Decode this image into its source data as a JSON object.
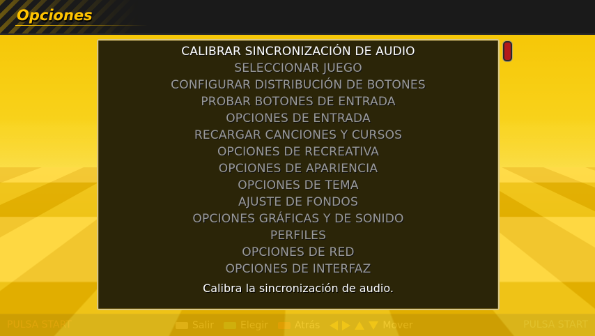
{
  "header": {
    "title": "Opciones"
  },
  "menu": {
    "items": [
      {
        "label": "CALIBRAR SINCRONIZACIÓN DE AUDIO",
        "selected": true
      },
      {
        "label": "SELECCIONAR JUEGO"
      },
      {
        "label": "CONFIGURAR DISTRIBUCIÓN DE BOTONES"
      },
      {
        "label": "PROBAR BOTONES DE ENTRADA"
      },
      {
        "label": "OPCIONES DE ENTRADA"
      },
      {
        "label": "RECARGAR CANCIONES Y CURSOS"
      },
      {
        "label": "OPCIONES DE RECREATIVA"
      },
      {
        "label": "OPCIONES DE APARIENCIA"
      },
      {
        "label": "OPCIONES DE TEMA"
      },
      {
        "label": "AJUSTE DE FONDOS"
      },
      {
        "label": "OPCIONES GRÁFICAS Y DE SONIDO"
      },
      {
        "label": "PERFILES"
      },
      {
        "label": "OPCIONES DE RED"
      },
      {
        "label": "OPCIONES DE INTERFAZ"
      }
    ],
    "description": "Calibra la sincronización de audio."
  },
  "footer": {
    "p1_start": "PULSA START",
    "p2_start": "PULSA START",
    "legend": {
      "exit": "Salir",
      "choose": "Elegir",
      "back": "Atrás",
      "move": "Mover"
    }
  },
  "colors": {
    "accent": "#ffc400",
    "p1": "#e25a6a",
    "p2": "#6aa8e8",
    "panel_bg": "#2b2508"
  }
}
